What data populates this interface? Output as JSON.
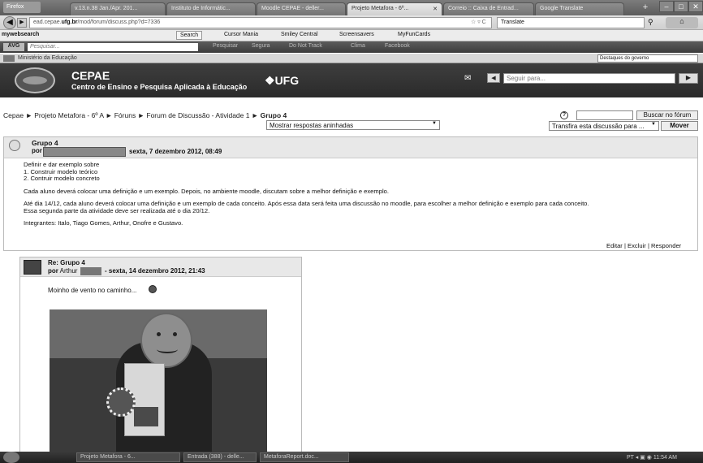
{
  "browser": {
    "app_button": "Firefox",
    "tabs": [
      {
        "label": "v.13.n.38 Jan./Apr. 201...",
        "active": false
      },
      {
        "label": "Instituto de Informátic...",
        "active": false
      },
      {
        "label": "Moodle CEPAE - deller...",
        "active": false
      },
      {
        "label": "Projeto Metafora - 6º...",
        "active": true
      },
      {
        "label": "Correio :: Caixa de Entrad...",
        "active": false
      },
      {
        "label": "Google Translate",
        "active": false
      }
    ],
    "new_tab": "+",
    "url_prefix": "ead.cepae.",
    "url_domain": "ufg.br",
    "url_path": "/mod/forum/discuss.php?d=7336",
    "translate_label": "Translate"
  },
  "toolbar1": {
    "brand": "mywebsearch",
    "search_label": "Search",
    "items": [
      "Cursor Mania",
      "Smiley Central",
      "Screensavers",
      "MyFunCards"
    ]
  },
  "toolbar2": {
    "logo": "AVG",
    "placeholder": "Pesquisar...",
    "items": [
      "Pesquisar",
      "Segura",
      "Do Not Track",
      "Clima",
      "Facebook"
    ]
  },
  "govbar": {
    "text": "Ministério da Educação",
    "select": "Destaques do governo"
  },
  "header": {
    "title": "CEPAE",
    "subtitle": "Centro de Ensino e Pesquisa Aplicada à Educação",
    "ufg": "UFG",
    "seguir_placeholder": "Seguir para..."
  },
  "breadcrumb": {
    "items": [
      "Cepae",
      "Projeto Metafora - 6º A",
      "Fóruns",
      "Forum de Discussão - Atividade 1"
    ],
    "separator": "►",
    "current": "Grupo 4"
  },
  "controls": {
    "display_mode": "Mostrar respostas aninhadas",
    "search_button": "Buscar no fórum",
    "move_select": "Transfira esta discussão para ...",
    "move_button": "Mover"
  },
  "post1": {
    "subject": "Grupo 4",
    "by_label": "por",
    "date": "sexta, 7 dezembro 2012, 08:49",
    "lines": [
      "Definir e dar exemplo sobre",
      "1. Construir modelo teórico",
      "2. Contruir modelo concreto"
    ],
    "para1": "Cada aluno deverá colocar uma definição e um exemplo. Depois, no ambiente moodle, discutam sobre a melhor definição e exemplo.",
    "para2a": "Até dia 14/12, cada aluno deverá colocar uma definição e um exemplo de cada conceito. Após essa data será feita uma discussão no moodle, para escolher a melhor definição e exemplo para cada conceito.",
    "para2b": "Essa segunda parte da atividade deve ser realizada até o dia 20/12.",
    "members": "Integrantes: Italo, Tiago Gomes, Arthur, Onofre e Gustavo.",
    "actions": {
      "edit": "Editar",
      "delete": "Excluir",
      "reply": "Responder",
      "sep": " | "
    }
  },
  "post2": {
    "subject": "Re: Grupo 4",
    "by_label": "por",
    "author": "Arthur",
    "date": "- sexta, 14 dezembro 2012, 21:43",
    "text": "Moinho de vento no caminho..."
  },
  "taskbar": {
    "tasks": [
      "Projeto Metafora - 6...",
      "Entrada (388) - delle...",
      "MetaforaReport.doc..."
    ],
    "locale": "PT",
    "clock": "11:54 AM"
  }
}
